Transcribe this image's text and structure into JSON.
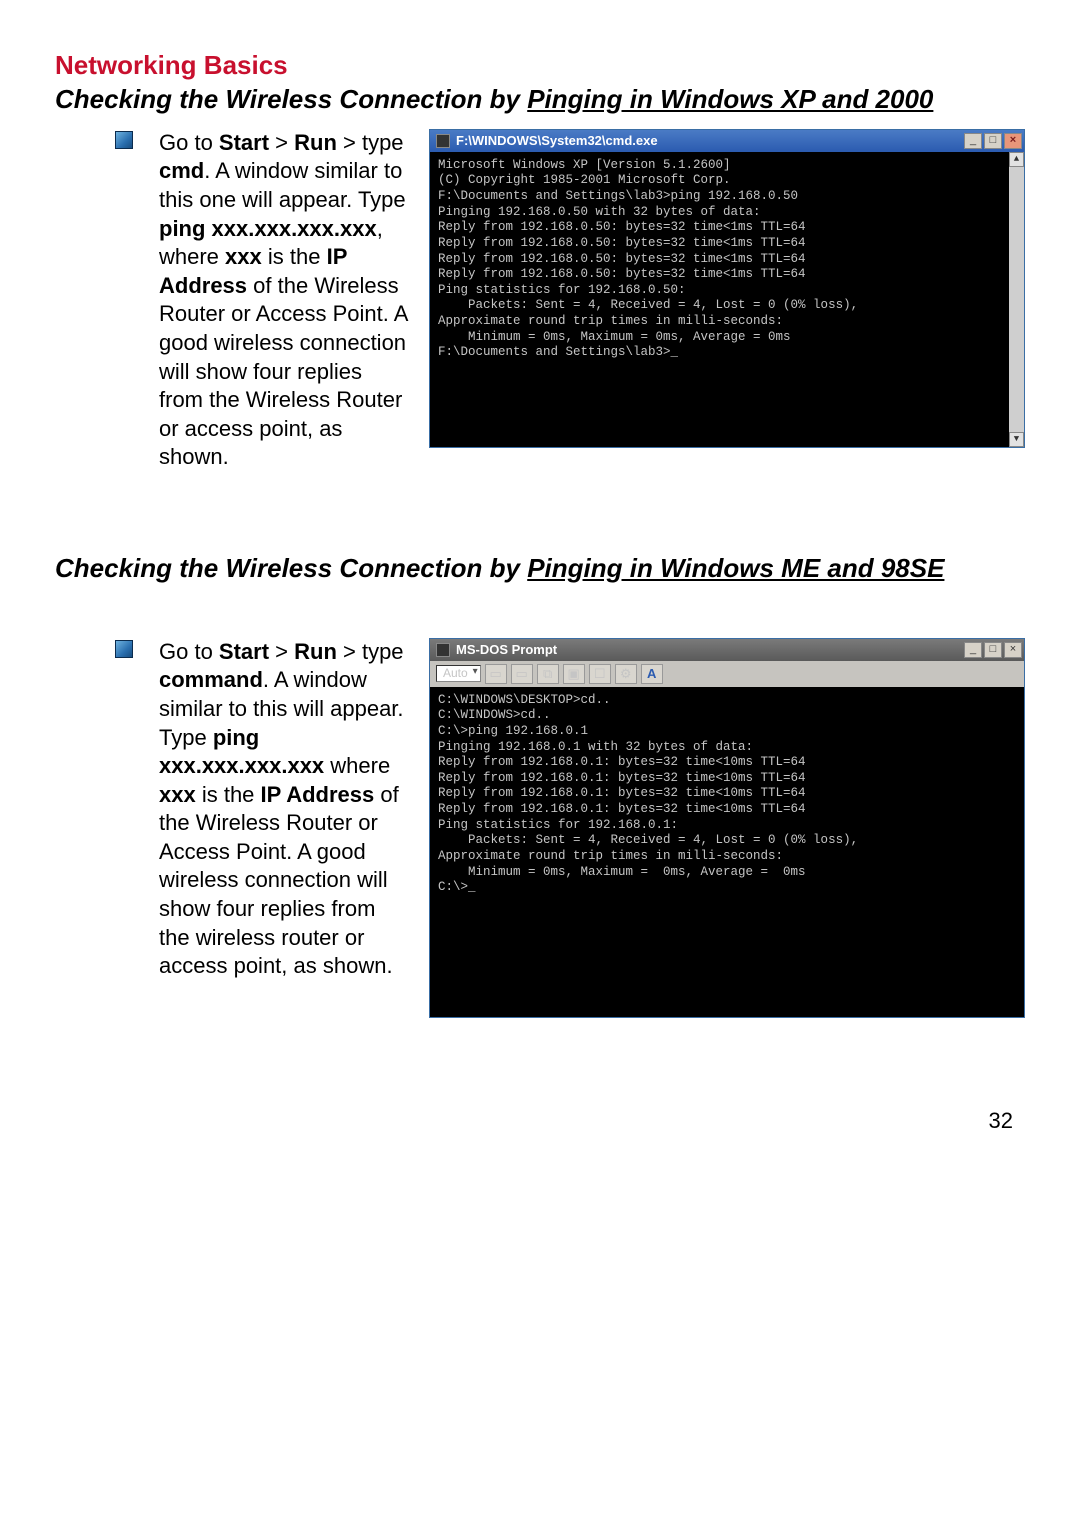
{
  "page": {
    "heading": "Networking Basics",
    "number": "32"
  },
  "section1": {
    "title_prefix": "Checking the Wireless Connection by ",
    "title_underline": "Pinging in Windows XP and 2000",
    "instruction_parts": {
      "t0": "Go to ",
      "b0": "Start",
      "t1": " > ",
      "b1": "Run",
      "t2": " > type ",
      "b2": "cmd",
      "t3": ".  A window similar to this one will appear.  Type ",
      "b3": "ping xxx.xxx.xxx.xxx",
      "t4": ", where ",
      "b4": "xxx",
      "t5": " is the ",
      "b5": "IP Address",
      "t6": " of the Wireless Router or Access Point.  A good wireless connection will show four replies from the Wireless Router or access point, as shown."
    },
    "window": {
      "title": "F:\\WINDOWS\\System32\\cmd.exe",
      "lines": [
        "Microsoft Windows XP [Version 5.1.2600]",
        "(C) Copyright 1985-2001 Microsoft Corp.",
        "",
        "F:\\Documents and Settings\\lab3>ping 192.168.0.50",
        "",
        "Pinging 192.168.0.50 with 32 bytes of data:",
        "",
        "Reply from 192.168.0.50: bytes=32 time<1ms TTL=64",
        "Reply from 192.168.0.50: bytes=32 time<1ms TTL=64",
        "Reply from 192.168.0.50: bytes=32 time<1ms TTL=64",
        "Reply from 192.168.0.50: bytes=32 time<1ms TTL=64",
        "",
        "Ping statistics for 192.168.0.50:",
        "    Packets: Sent = 4, Received = 4, Lost = 0 (0% loss),",
        "Approximate round trip times in milli-seconds:",
        "    Minimum = 0ms, Maximum = 0ms, Average = 0ms",
        "",
        "F:\\Documents and Settings\\lab3>_"
      ]
    }
  },
  "section2": {
    "title_prefix": "Checking the Wireless Connection by ",
    "title_underline": "Pinging in Windows ME and 98SE",
    "instruction_parts": {
      "t0": "Go to ",
      "b0": "Start",
      "t1": " > ",
      "b1": "Run",
      "t2": " > type ",
      "b2": "command",
      "t3": ".  A window similar to this will appear. Type ",
      "b3": "ping xxx.xxx.xxx.xxx",
      "t4": " where ",
      "b4": "xxx",
      "t5": " is the ",
      "b5": "IP Address",
      "t6": " of the Wireless Router or Access Point.  A good wireless connection will show four replies from the wireless router or access point, as shown."
    },
    "window": {
      "title": "MS-DOS Prompt",
      "toolbar_select": "Auto",
      "toolbar_letter": "A",
      "lines": [
        "C:\\WINDOWS\\DESKTOP>cd..",
        "",
        "C:\\WINDOWS>cd..",
        "",
        "C:\\>ping 192.168.0.1",
        "",
        "Pinging 192.168.0.1 with 32 bytes of data:",
        "",
        "Reply from 192.168.0.1: bytes=32 time<10ms TTL=64",
        "Reply from 192.168.0.1: bytes=32 time<10ms TTL=64",
        "Reply from 192.168.0.1: bytes=32 time<10ms TTL=64",
        "Reply from 192.168.0.1: bytes=32 time<10ms TTL=64",
        "",
        "Ping statistics for 192.168.0.1:",
        "    Packets: Sent = 4, Received = 4, Lost = 0 (0% loss),",
        "Approximate round trip times in milli-seconds:",
        "    Minimum = 0ms, Maximum =  0ms, Average =  0ms",
        "",
        "C:\\>_"
      ]
    }
  }
}
